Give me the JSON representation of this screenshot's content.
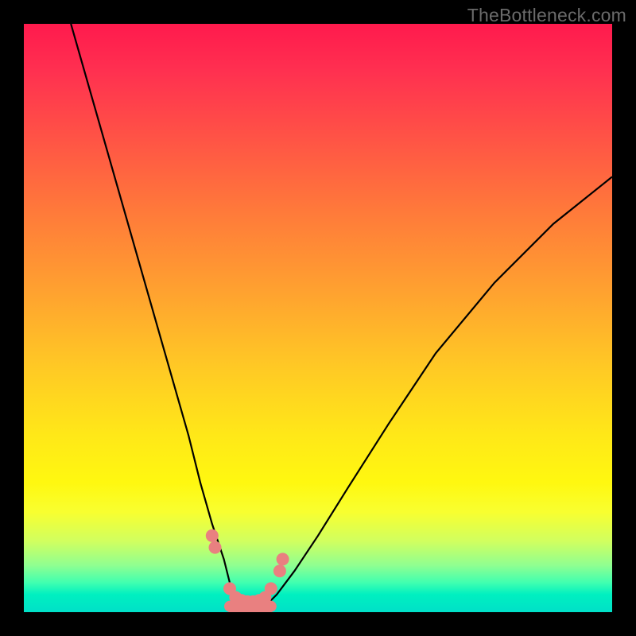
{
  "watermark": "TheBottleneck.com",
  "chart_data": {
    "type": "line",
    "title": "",
    "xlabel": "",
    "ylabel": "",
    "xlim": [
      0,
      100
    ],
    "ylim": [
      0,
      100
    ],
    "background_gradient": {
      "top_color": "#ff1a4d",
      "bottom_color": "#00e0c8",
      "meaning": "red high to green low"
    },
    "series": [
      {
        "name": "left-curve",
        "x": [
          8,
          12,
          16,
          20,
          24,
          28,
          30,
          32,
          34,
          35,
          36,
          37
        ],
        "y": [
          100,
          86,
          72,
          58,
          44,
          30,
          22,
          15,
          9,
          5,
          2,
          1
        ]
      },
      {
        "name": "right-curve",
        "x": [
          41,
          43,
          46,
          50,
          55,
          62,
          70,
          80,
          90,
          100
        ],
        "y": [
          1,
          3,
          7,
          13,
          21,
          32,
          44,
          56,
          66,
          74
        ]
      },
      {
        "name": "valley-floor",
        "x": [
          35,
          36,
          37,
          38,
          39,
          40,
          41,
          42
        ],
        "y": [
          1,
          0.5,
          0.3,
          0.3,
          0.3,
          0.3,
          0.5,
          1
        ]
      }
    ],
    "markers": [
      {
        "x": 32,
        "y": 13
      },
      {
        "x": 32.5,
        "y": 11
      },
      {
        "x": 35,
        "y": 4
      },
      {
        "x": 36,
        "y": 2.5
      },
      {
        "x": 37,
        "y": 2
      },
      {
        "x": 38,
        "y": 1.8
      },
      {
        "x": 39,
        "y": 1.8
      },
      {
        "x": 40,
        "y": 2
      },
      {
        "x": 41,
        "y": 2.5
      },
      {
        "x": 42,
        "y": 4
      },
      {
        "x": 43.5,
        "y": 7
      },
      {
        "x": 44,
        "y": 9
      }
    ],
    "marker_color": "#e98080",
    "curve_color": "#000000"
  }
}
